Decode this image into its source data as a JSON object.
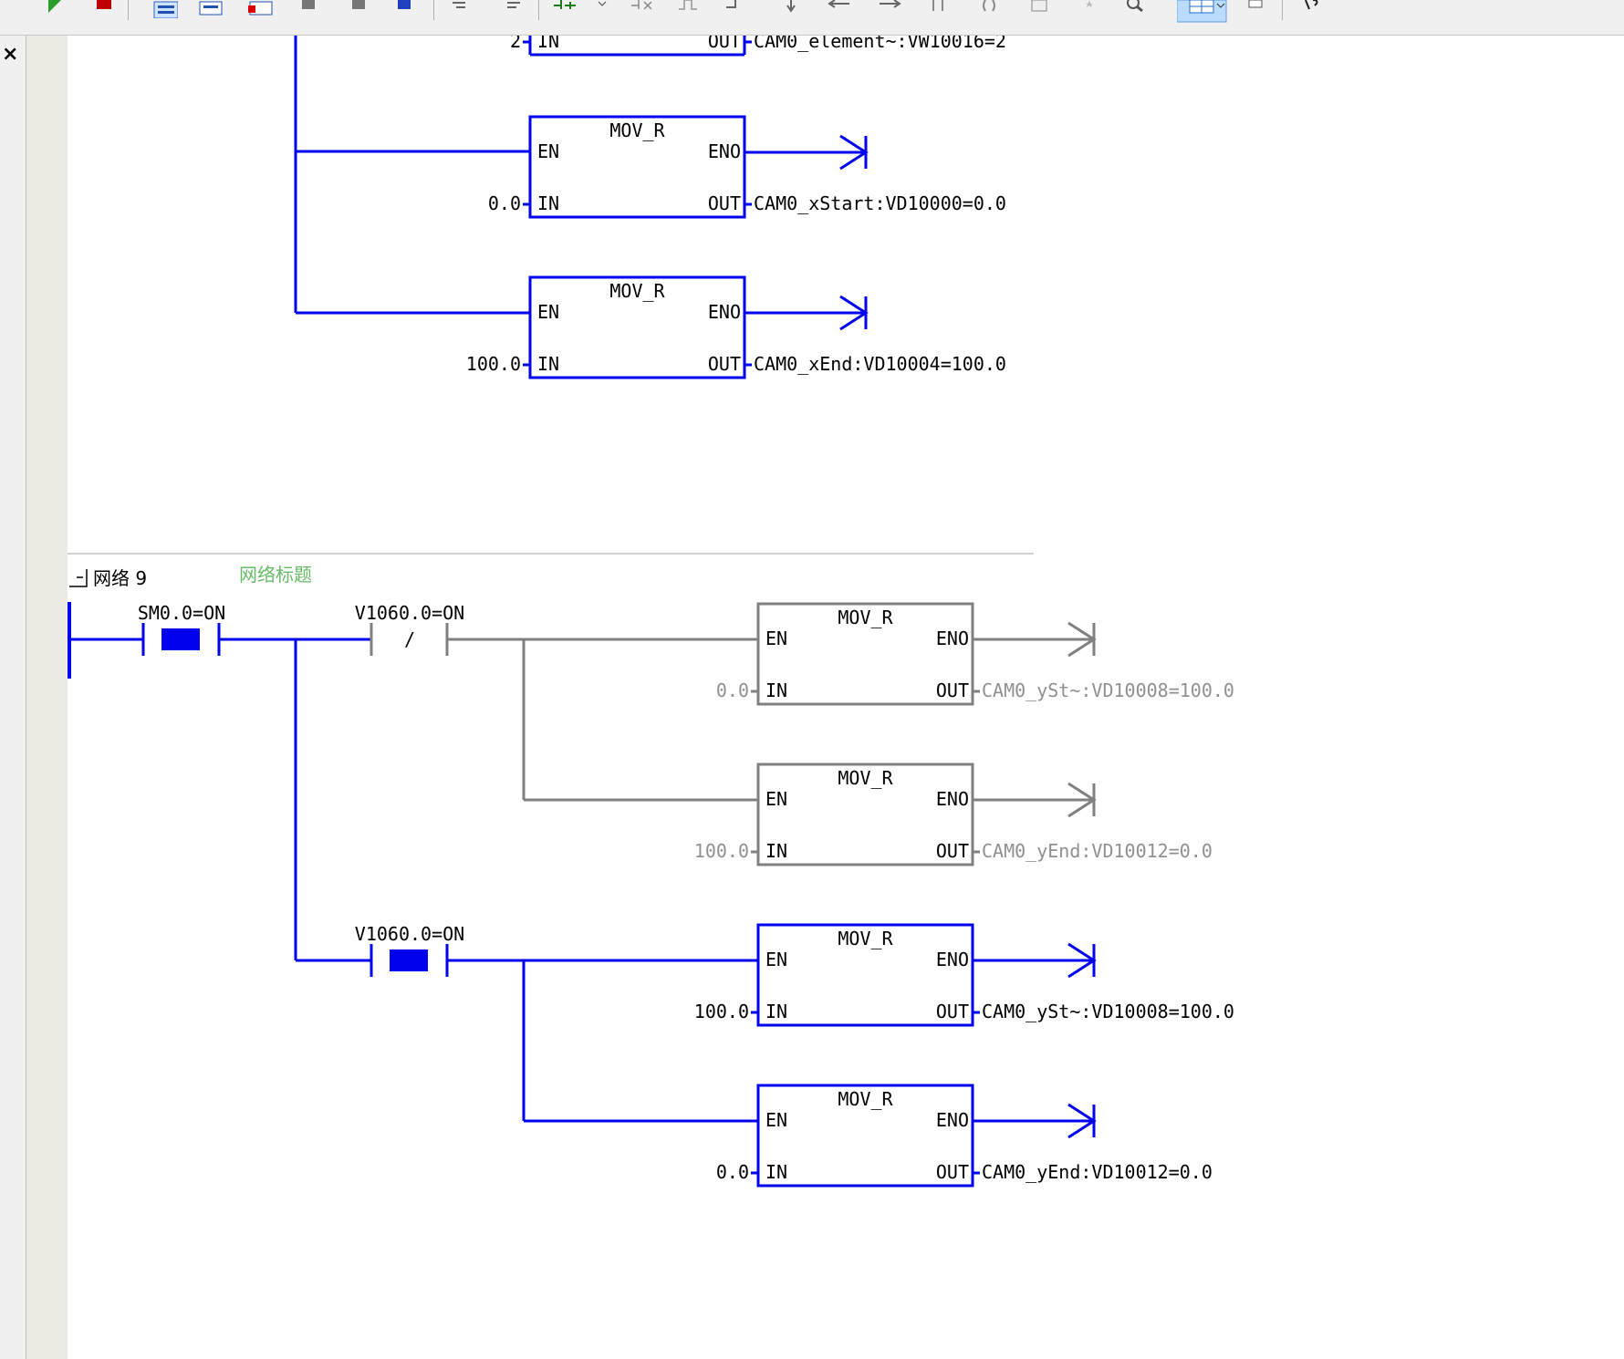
{
  "toolbar": {
    "icons": [
      "run-icon",
      "stop-icon",
      "insert-network-icon",
      "delete-network-icon",
      "insert-row-icon",
      "lock-icon",
      "lock-icon-2",
      "lock-icon-3",
      "indent-icon",
      "outdent-icon",
      "insert-contact-icon",
      "dropdown-arrow-icon",
      "delete-contact-icon",
      "rising-edge-icon",
      "branch-icon",
      "down-arrow-icon",
      "left-arrow-icon",
      "right-arrow-icon",
      "contact-icon",
      "coil-icon",
      "box-icon",
      "bookmark-star-icon",
      "find-icon",
      "table-view-icon",
      "view-dropdown-icon",
      "monitor-icon",
      "help-icon"
    ]
  },
  "network8": {
    "blocks": [
      {
        "name": "",
        "en": "",
        "eno": "",
        "in_label": "IN",
        "out_label": "OUT",
        "in_value": "2",
        "out_text": "CAM0_element~:VW10016=2",
        "state": "active"
      },
      {
        "name": "MOV_R",
        "en": "EN",
        "eno": "ENO",
        "in_label": "IN",
        "out_label": "OUT",
        "in_value": "0.0",
        "out_text": "CAM0_xStart:VD10000=0.0",
        "state": "active"
      },
      {
        "name": "MOV_R",
        "en": "EN",
        "eno": "ENO",
        "in_label": "IN",
        "out_label": "OUT",
        "in_value": "100.0",
        "out_text": "CAM0_xEnd:VD10004=100.0",
        "state": "active"
      }
    ]
  },
  "network9": {
    "header": "网络 9",
    "title_placeholder": "网络标题",
    "contacts": [
      {
        "label": "SM0.0=ON",
        "type": "NO",
        "state": "active"
      },
      {
        "label": "V1060.0=ON",
        "type": "NC",
        "state": "inactive"
      },
      {
        "label": "V1060.0=ON",
        "type": "NO",
        "state": "active"
      }
    ],
    "nc_symbol": "/",
    "blocks": [
      {
        "name": "MOV_R",
        "en": "EN",
        "eno": "ENO",
        "in_label": "IN",
        "out_label": "OUT",
        "in_value": "0.0",
        "out_text": "CAM0_ySt~:VD10008=100.0",
        "state": "inactive"
      },
      {
        "name": "MOV_R",
        "en": "EN",
        "eno": "ENO",
        "in_label": "IN",
        "out_label": "OUT",
        "in_value": "100.0",
        "out_text": "CAM0_yEnd:VD10012=0.0",
        "state": "inactive"
      },
      {
        "name": "MOV_R",
        "en": "EN",
        "eno": "ENO",
        "in_label": "IN",
        "out_label": "OUT",
        "in_value": "100.0",
        "out_text": "CAM0_ySt~:VD10008=100.0",
        "state": "active"
      },
      {
        "name": "MOV_R",
        "en": "EN",
        "eno": "ENO",
        "in_label": "IN",
        "out_label": "OUT",
        "in_value": "0.0",
        "out_text": "CAM0_yEnd:VD10012=0.0",
        "state": "active"
      }
    ]
  },
  "colors": {
    "active": "#0000ee",
    "inactive": "#808080",
    "title": "#66bb66",
    "text": "#000000",
    "inactive_text": "#909090"
  }
}
